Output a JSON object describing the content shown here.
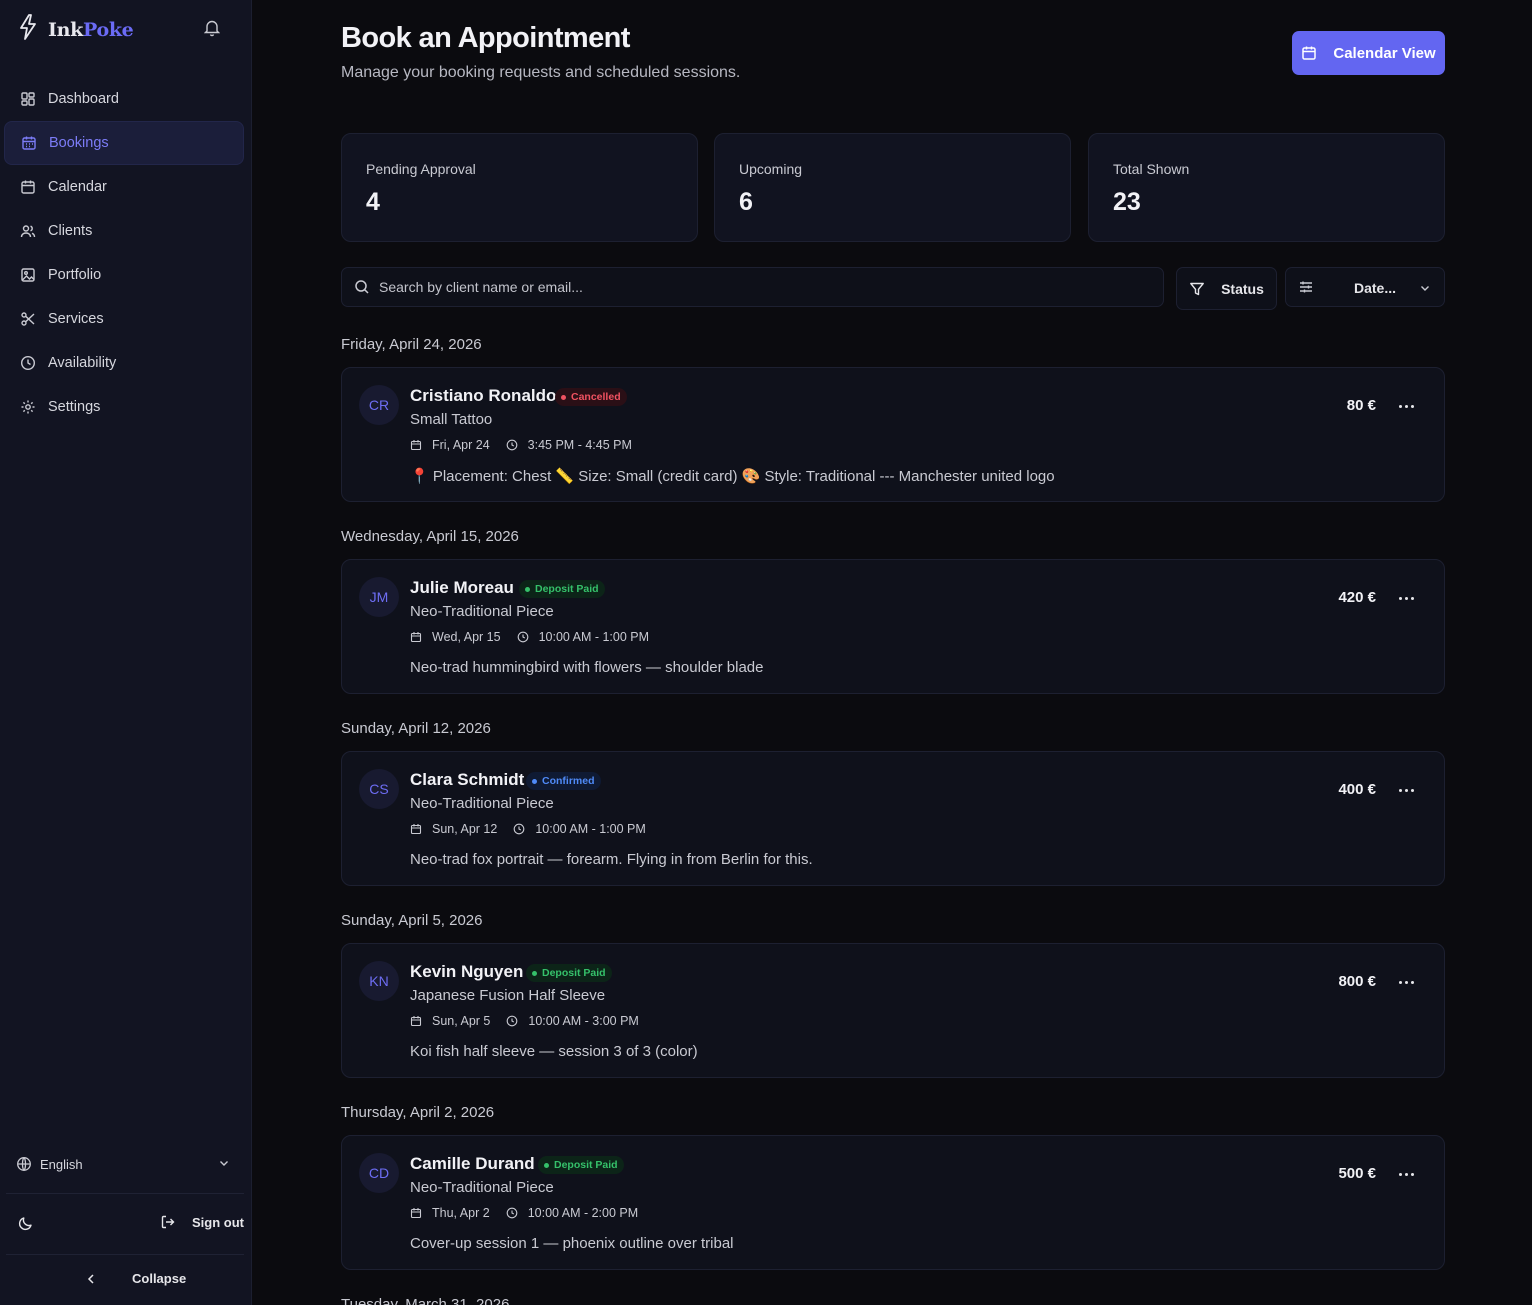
{
  "app": {
    "brand_ink": "Ink",
    "brand_poke": "Poke"
  },
  "sidebar": {
    "items": [
      {
        "label": "Dashboard",
        "icon": "layout-grid-icon",
        "active": false
      },
      {
        "label": "Bookings",
        "icon": "calendar-grid-icon",
        "active": true
      },
      {
        "label": "Calendar",
        "icon": "calendar-icon",
        "active": false
      },
      {
        "label": "Clients",
        "icon": "users-icon",
        "active": false
      },
      {
        "label": "Portfolio",
        "icon": "image-icon",
        "active": false
      },
      {
        "label": "Services",
        "icon": "scissors-icon",
        "active": false
      },
      {
        "label": "Availability",
        "icon": "clock-icon",
        "active": false
      },
      {
        "label": "Settings",
        "icon": "gear-icon",
        "active": false
      }
    ],
    "language": "English",
    "sign_out": "Sign out",
    "collapse": "Collapse"
  },
  "header": {
    "title": "Book an Appointment",
    "subtitle": "Manage your booking requests and scheduled sessions.",
    "calendar_view": "Calendar View"
  },
  "stats": [
    {
      "label": "Pending Approval",
      "value": "4"
    },
    {
      "label": "Upcoming",
      "value": "6"
    },
    {
      "label": "Total Shown",
      "value": "23"
    }
  ],
  "filters": {
    "search_placeholder": "Search by client name or email...",
    "status": "Status",
    "date": "Date..."
  },
  "groups": [
    {
      "date": "Friday, April 24, 2026",
      "booking": {
        "initials": "CR",
        "name": "Cristiano Ronaldo",
        "status": "Cancelled",
        "status_kind": "cancelled",
        "service": "Small Tattoo",
        "day": "Fri, Apr 24",
        "time": "3:45 PM - 4:45 PM",
        "notes": "📍 Placement: Chest 📏 Size: Small (credit card) 🎨 Style: Traditional --- Manchester united logo",
        "price": "80 €"
      }
    },
    {
      "date": "Wednesday, April 15, 2026",
      "booking": {
        "initials": "JM",
        "name": "Julie Moreau",
        "status": "Deposit Paid",
        "status_kind": "paid",
        "service": "Neo-Traditional Piece",
        "day": "Wed, Apr 15",
        "time": "10:00 AM - 1:00 PM",
        "notes": "Neo-trad hummingbird with flowers — shoulder blade",
        "price": "420 €"
      }
    },
    {
      "date": "Sunday, April 12, 2026",
      "booking": {
        "initials": "CS",
        "name": "Clara Schmidt",
        "status": "Confirmed",
        "status_kind": "confirmed",
        "service": "Neo-Traditional Piece",
        "day": "Sun, Apr 12",
        "time": "10:00 AM - 1:00 PM",
        "notes": "Neo-trad fox portrait — forearm. Flying in from Berlin for this.",
        "price": "400 €"
      }
    },
    {
      "date": "Sunday, April 5, 2026",
      "booking": {
        "initials": "KN",
        "name": "Kevin Nguyen",
        "status": "Deposit Paid",
        "status_kind": "paid",
        "service": "Japanese Fusion Half Sleeve",
        "day": "Sun, Apr 5",
        "time": "10:00 AM - 3:00 PM",
        "notes": "Koi fish half sleeve — session 3 of 3 (color)",
        "price": "800 €"
      }
    },
    {
      "date": "Thursday, April 2, 2026",
      "booking": {
        "initials": "CD",
        "name": "Camille Durand",
        "status": "Deposit Paid",
        "status_kind": "paid",
        "service": "Neo-Traditional Piece",
        "day": "Thu, Apr 2",
        "time": "10:00 AM - 2:00 PM",
        "notes": "Cover-up session 1 — phoenix outline over tribal",
        "price": "500 €"
      }
    },
    {
      "date": "Tuesday, March 31, 2026"
    }
  ],
  "colors": {
    "accent": "#6366f1",
    "cancelled": "#f05261",
    "paid": "#35c06a",
    "confirmed": "#4f8af7"
  }
}
